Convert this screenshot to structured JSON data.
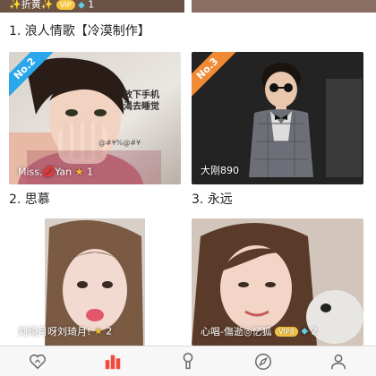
{
  "top_card": {
    "caption": "✨折黄✨",
    "vip": "VIP",
    "count": "1"
  },
  "ranks": [
    {
      "label": "1. 浪人情歌【冷漠制作】"
    },
    {
      "label": "2. 思慕",
      "badge": "No.2",
      "name": "Miss.💋Yan",
      "count": "1"
    },
    {
      "label": "3. 永远",
      "badge": "No.3",
      "name": "大刚890"
    }
  ],
  "cards_row3": [
    {
      "name": "刘琦月呀刘琦月!",
      "count": "2"
    },
    {
      "name": "心唱-傷逝◎忆狐",
      "vip": "VIP8",
      "count": "2"
    }
  ],
  "card2_overlay": {
    "line1": "放下手机",
    "line2": "渴去睡觉",
    "watermark": "@#¥%@#¥"
  },
  "colors": {
    "accent": "#f04a3e",
    "ribbon_blue": "#2aa7ea",
    "ribbon_orange": "#f08a33"
  },
  "tabs": [
    {
      "icon": "heart-hand-icon",
      "active": false
    },
    {
      "icon": "bar-chart-icon",
      "active": true
    },
    {
      "icon": "microphone-icon",
      "active": false
    },
    {
      "icon": "compass-icon",
      "active": false
    },
    {
      "icon": "person-icon",
      "active": false
    }
  ]
}
